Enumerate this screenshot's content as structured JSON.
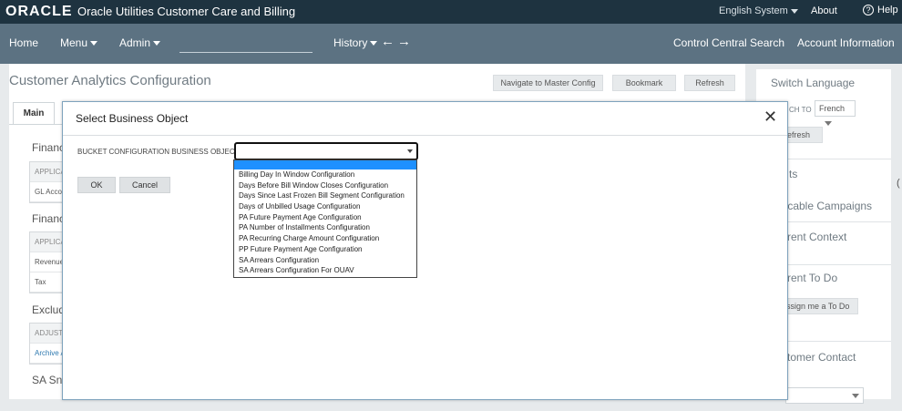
{
  "brand": {
    "logo": "ORACLE",
    "title": "Oracle Utilities Customer Care and Billing",
    "user_menu": "English System",
    "about": "About",
    "help": "Help"
  },
  "nav": {
    "home": "Home",
    "menu": "Menu",
    "admin": "Admin",
    "history": "History",
    "back_icon": "arrow-left-icon",
    "forward_icon": "arrow-right-icon",
    "control_central": "Control Central Search",
    "account_info": "Account Information"
  },
  "page": {
    "title": "Customer Analytics Configuration",
    "buttons": {
      "navigate": "Navigate to Master Config",
      "bookmark": "Bookmark",
      "refresh": "Refresh"
    },
    "tab_main": "Main",
    "sections": [
      {
        "label": "Financ",
        "header": "APPLICA",
        "rows": [
          "GL Accou"
        ]
      },
      {
        "label": "Financ",
        "header": "APPLICA",
        "rows": [
          "Revenue",
          "Tax"
        ]
      },
      {
        "label": "Exclude",
        "header": "ADJUST",
        "rows": [
          "Archive A"
        ]
      },
      {
        "label": "SA Snap"
      }
    ]
  },
  "right_panel": {
    "switch_language": "Switch Language",
    "switch_to_label": "CH TO",
    "language_value": "French",
    "refresh": "efresh",
    "alerts": "ts",
    "campaigns": "licable Campaigns",
    "context": "rent Context",
    "todo": "rent To Do",
    "assign_todo": "ssign me a To Do",
    "contact": "tomer Contact"
  },
  "dialog": {
    "title": "Select Business Object",
    "close_icon": "close-icon",
    "field_label": "BUCKET CONFIGURATION BUSINESS OBJECT",
    "field_value": "",
    "ok": "OK",
    "cancel": "Cancel",
    "options": [
      "",
      "Billing Day In Window Configuration",
      "Days Before Bill Window Closes Configuration",
      "Days Since Last Frozen Bill Segment Configuration",
      "Days of Unbilled Usage Configuration",
      "PA Future Payment Age Configuration",
      "PA Number of Installments Configuration",
      "PA Recurring Charge Amount Configuration",
      "PP Future Payment Age Configuration",
      "SA Arrears Configuration",
      "SA Arrears Configuration For OUAV"
    ]
  }
}
